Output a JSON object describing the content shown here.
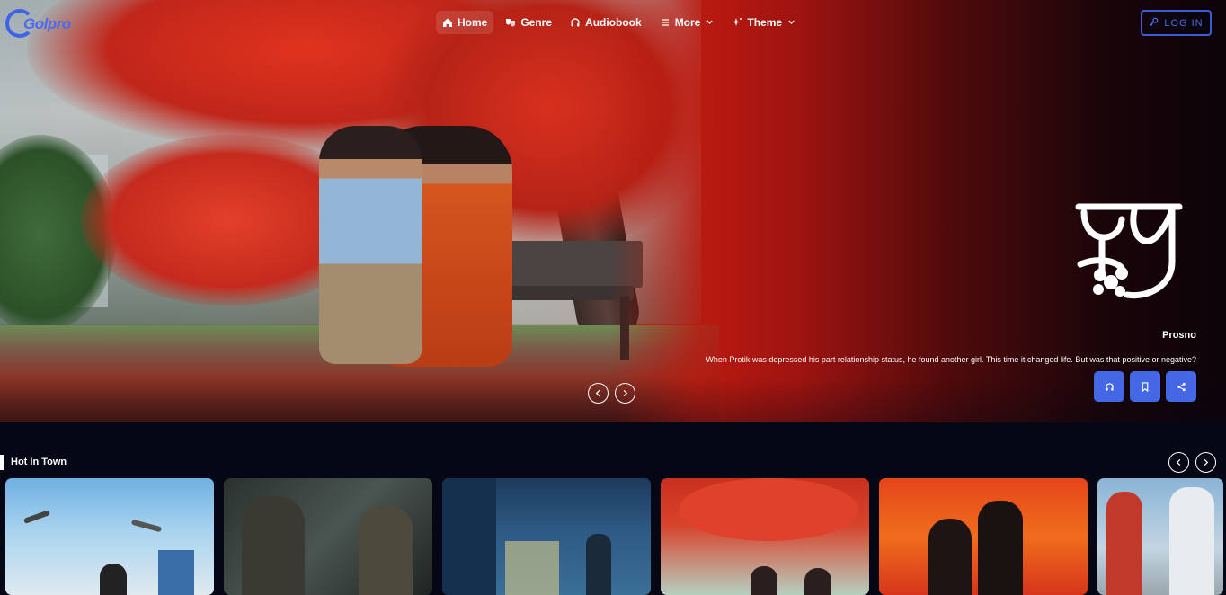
{
  "brand": {
    "logo_text": "Golpro"
  },
  "nav": {
    "items": [
      {
        "label": "Home",
        "icon": "home-icon",
        "active": true
      },
      {
        "label": "Genre",
        "icon": "masks-icon"
      },
      {
        "label": "Audiobook",
        "icon": "headphones-icon"
      },
      {
        "label": "More",
        "icon": "menu-icon",
        "dropdown": true
      },
      {
        "label": "Theme",
        "icon": "sparkle-icon",
        "dropdown": true
      }
    ]
  },
  "auth": {
    "login_label": "LOG IN",
    "icon": "key-icon"
  },
  "hero": {
    "title_art": "প্রশ্ন",
    "title": "Prosno",
    "description": "When Protik was depressed his part relationship status, he found another girl. This time it changed life. But was that positive or negative?",
    "actions": [
      {
        "name": "listen",
        "icon": "headphones-icon"
      },
      {
        "name": "bookmark",
        "icon": "bookmark-icon"
      },
      {
        "name": "share",
        "icon": "share-icon"
      }
    ],
    "prev_icon": "chevron-left-icon",
    "next_icon": "chevron-right-icon"
  },
  "section": {
    "title": "Hot In Town",
    "prev_icon": "chevron-left-icon",
    "next_icon": "chevron-right-icon",
    "cards": [
      {
        "name": "story-card-1"
      },
      {
        "name": "story-card-2"
      },
      {
        "name": "story-card-3"
      },
      {
        "name": "story-card-4"
      },
      {
        "name": "story-card-5"
      },
      {
        "name": "story-card-6"
      }
    ]
  },
  "colors": {
    "accent": "#4467e6",
    "background": "#050714",
    "hero_red": "#c11d10"
  }
}
